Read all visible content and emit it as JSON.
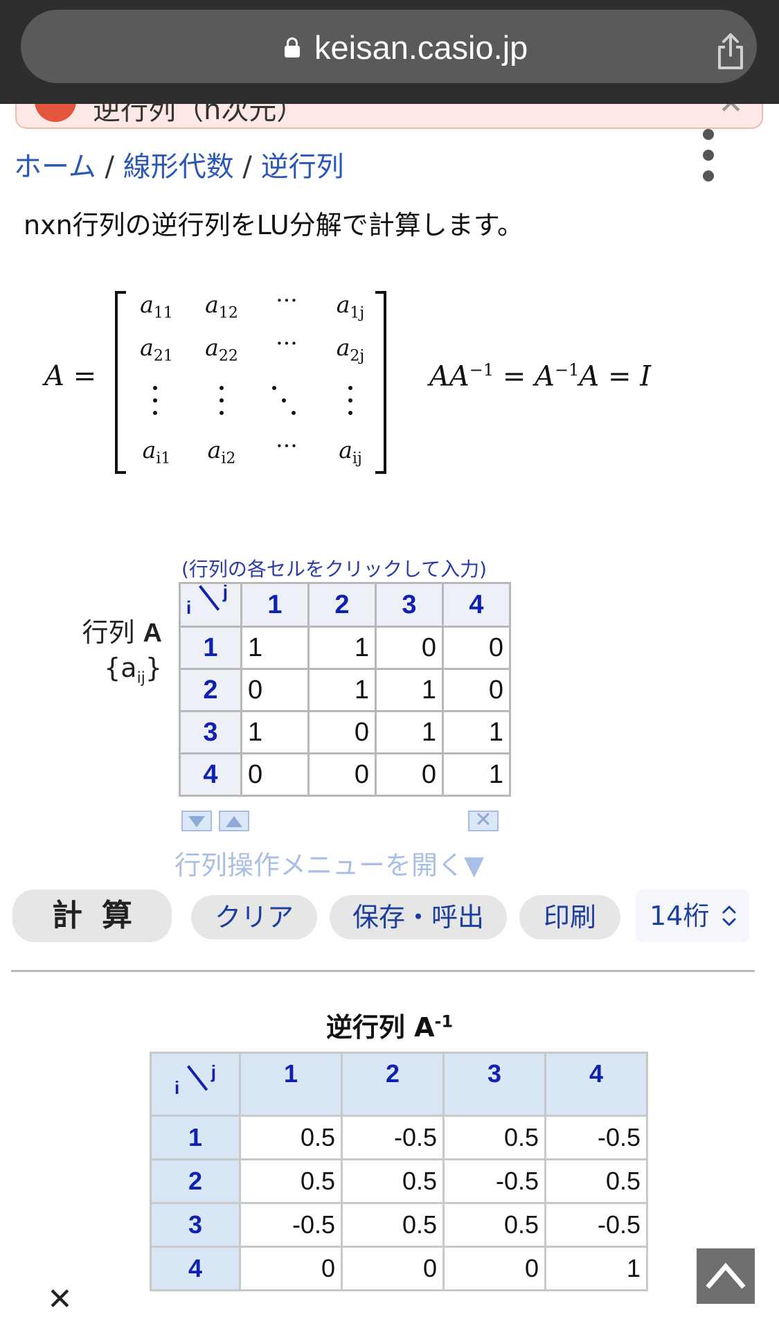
{
  "browser": {
    "url": "keisan.casio.jp"
  },
  "banner": {
    "partial_text": "逆行列（n次元）"
  },
  "breadcrumb": {
    "home": "ホーム",
    "sep1": " / ",
    "category": "線形代数",
    "sep2": " / ",
    "current": "逆行列"
  },
  "description": "nxn行列の逆行列をLU分解で計算します。",
  "formula": {
    "lhs": "A =",
    "matrix": {
      "r1": [
        "a",
        "11",
        "a",
        "12",
        "···",
        "a",
        "1j"
      ],
      "r2": [
        "a",
        "21",
        "a",
        "22",
        "···",
        "a",
        "2j"
      ],
      "r4": [
        "a",
        "i1",
        "a",
        "i2",
        "···",
        "a",
        "ij"
      ]
    },
    "inverse_rel": {
      "p1": "AA",
      "s1": "−1",
      "p2": " = A",
      "s2": "−1",
      "p3": "A = I"
    }
  },
  "input_matrix": {
    "hint": "(行列の各セルをクリックして入力)",
    "label": "行列",
    "label_symbol": "A",
    "label_sub_open": "{a",
    "label_sub": "ij",
    "label_sub_close": "}",
    "corner_i": "i",
    "corner_j": "j",
    "col_headers": [
      "1",
      "2",
      "3",
      "4"
    ],
    "row_headers": [
      "1",
      "2",
      "3",
      "4"
    ],
    "rows": [
      [
        "1",
        "1",
        "0",
        "0"
      ],
      [
        "0",
        "1",
        "1",
        "0"
      ],
      [
        "1",
        "0",
        "1",
        "1"
      ],
      [
        "0",
        "0",
        "0",
        "1"
      ]
    ],
    "menu_open": "行列操作メニューを開く▼"
  },
  "actions": {
    "calc": "計算",
    "clear": "クリア",
    "save_load": "保存・呼出",
    "print": "印刷",
    "digits": "14桁"
  },
  "result": {
    "title": "逆行列 A",
    "title_sup": "-1",
    "corner_i": "i",
    "corner_j": "j",
    "col_headers": [
      "1",
      "2",
      "3",
      "4"
    ],
    "row_headers": [
      "1",
      "2",
      "3",
      "4"
    ],
    "rows": [
      [
        "0.5",
        "-0.5",
        "0.5",
        "-0.5"
      ],
      [
        "0.5",
        "0.5",
        "-0.5",
        "0.5"
      ],
      [
        "-0.5",
        "0.5",
        "0.5",
        "-0.5"
      ],
      [
        "0",
        "0",
        "0",
        "1"
      ]
    ]
  },
  "icons": {
    "lock": "lock-icon",
    "share": "share-icon",
    "more": "more-vertical-icon",
    "close": "close-icon",
    "scroll_top": "chevron-up-icon"
  }
}
